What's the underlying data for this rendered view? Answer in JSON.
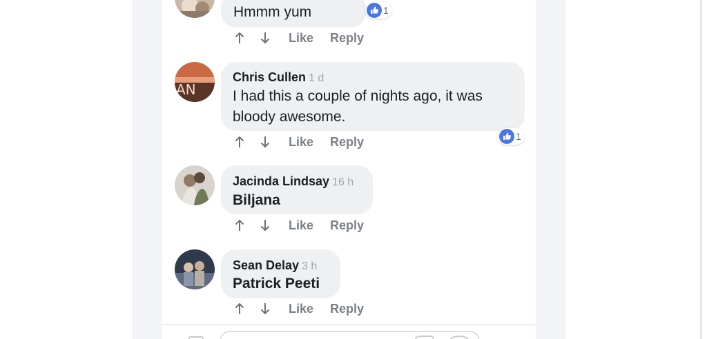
{
  "colors": {
    "accent": "#4a76e8",
    "bubble": "#eff0f2",
    "action_text": "#7c8087",
    "timestamp": "#a0a4aa"
  },
  "comments": [
    {
      "author": "",
      "time": "",
      "text": "Hmmm yum",
      "reaction": {
        "icon": "thumbs-up-icon",
        "count": "1"
      },
      "actions": {
        "up": "up-arrow-icon",
        "down": "down-arrow-icon",
        "like": "Like",
        "reply": "Reply"
      }
    },
    {
      "author": "Chris Cullen",
      "time": "1 d",
      "text_lines": [
        "I had this a couple of nights ago, it was",
        "bloody awesome."
      ],
      "reaction": {
        "icon": "thumbs-up-icon",
        "count": "1"
      },
      "actions": {
        "up": "up-arrow-icon",
        "down": "down-arrow-icon",
        "like": "Like",
        "reply": "Reply"
      }
    },
    {
      "author": "Jacinda Lindsay",
      "time": "16 h",
      "text": "Biljana",
      "actions": {
        "up": "up-arrow-icon",
        "down": "down-arrow-icon",
        "like": "Like",
        "reply": "Reply"
      }
    },
    {
      "author": "Sean Delay",
      "time": "3 h",
      "text": "Patrick Peeti",
      "actions": {
        "up": "up-arrow-icon",
        "down": "down-arrow-icon",
        "like": "Like",
        "reply": "Reply"
      }
    }
  ]
}
